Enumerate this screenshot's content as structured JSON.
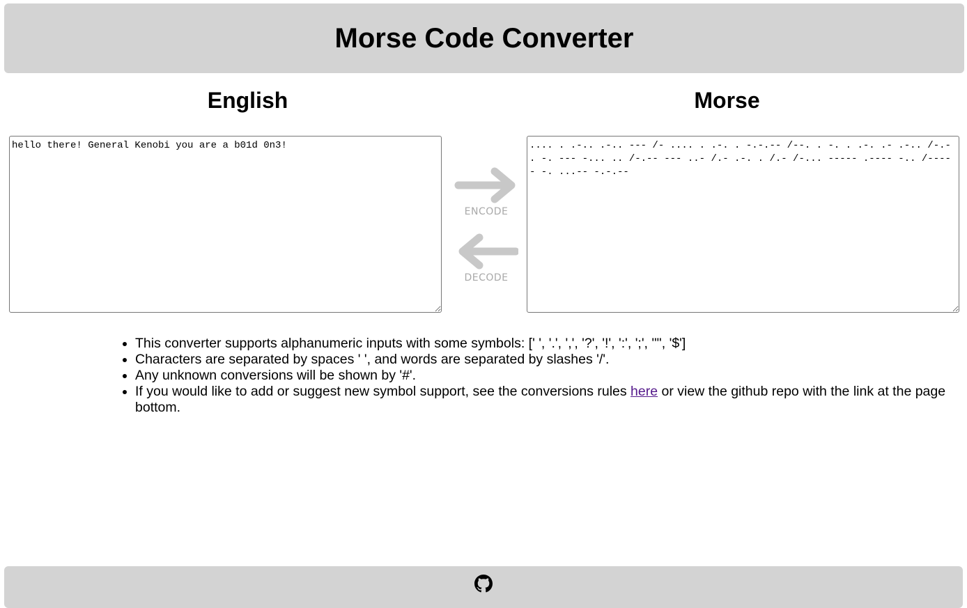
{
  "header": {
    "title": "Morse Code Converter"
  },
  "english": {
    "title": "English",
    "value": "hello there! General Kenobi you are a b01d 0n3!"
  },
  "morse": {
    "title": "Morse",
    "value": ".... . .-.. .-.. --- /- .... . .-. . -.-.-- /--. . -. . .-. .- .-.. /-.- . -. --- -... .. /-.-- --- ..- /.- .-. . /.- /-... ----- .---- -.. /----- -. ...-- -.-.--"
  },
  "actions": {
    "encode": {
      "label": "ENCODE",
      "icon": "arrow-right-icon"
    },
    "decode": {
      "label": "DECODE",
      "icon": "arrow-left-icon"
    }
  },
  "info": {
    "items": [
      "This converter supports alphanumeric inputs with some symbols: [' ', '.', ',', '?', '!', ':', ';', '\"', '$']",
      "Characters are separated by spaces ' ', and words are separated by slashes '/'.",
      "Any unknown conversions will be shown by '#'.",
      {
        "before": "If you would like to add or suggest new symbol support, see the conversions rules ",
        "link": "here",
        "after": " or view the github repo with the link at the page bottom."
      }
    ]
  },
  "footer": {
    "icon": "github-icon"
  },
  "colors": {
    "panel": "#d3d3d3",
    "arrow": "#c8c8c8",
    "action_label": "#a9a9a9",
    "link": "#551a8b"
  }
}
